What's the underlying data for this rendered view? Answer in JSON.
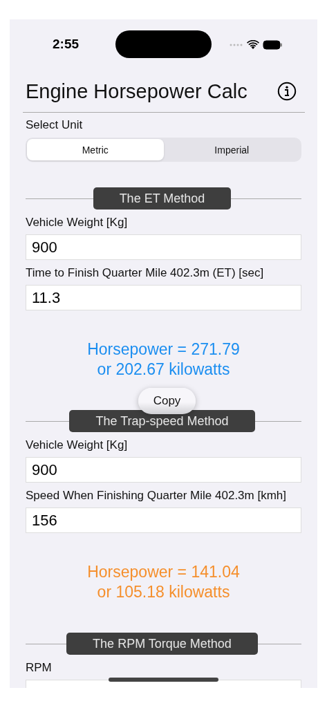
{
  "status_bar": {
    "time": "2:55"
  },
  "header": {
    "title": "Engine Horsepower Calc"
  },
  "unit_picker": {
    "label": "Select Unit",
    "options": [
      {
        "label": "Metric",
        "selected": true
      },
      {
        "label": "Imperial",
        "selected": false
      }
    ]
  },
  "sections": [
    {
      "title": "The ET Method",
      "fields": [
        {
          "label": "Vehicle Weight [Kg]",
          "value": "900"
        },
        {
          "label": "Time to Finish Quarter Mile 402.3m (ET) [sec]",
          "value": "11.3"
        }
      ],
      "result": {
        "color": "#1b8ef0",
        "lines": [
          "Horsepower = 271.79",
          "or 202.67 kilowatts"
        ]
      }
    },
    {
      "title": "The Trap-speed Method",
      "fields": [
        {
          "label": "Vehicle Weight [Kg]",
          "value": "900"
        },
        {
          "label": "Speed When Finishing Quarter Mile 402.3m [kmh]",
          "value": "156"
        }
      ],
      "result": {
        "color": "#f58f2c",
        "lines": [
          "Horsepower = 141.04",
          "or 105.18 kilowatts"
        ]
      }
    },
    {
      "title": "The RPM Torque Method",
      "fields": [
        {
          "label": "RPM"
        }
      ]
    }
  ],
  "context_menu": {
    "items": [
      "Copy"
    ]
  }
}
